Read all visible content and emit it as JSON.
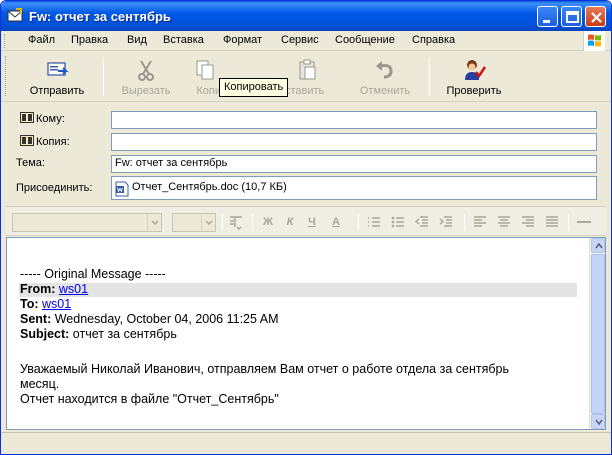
{
  "window": {
    "title": "Fw: отчет за сентябрь",
    "controls": [
      "minimize-icon",
      "maximize-icon",
      "close-icon"
    ]
  },
  "menu": {
    "items": [
      "Файл",
      "Правка",
      "Вид",
      "Вставка",
      "Формат",
      "Сервис",
      "Сообщение",
      "Справка"
    ]
  },
  "toolbar": {
    "send": "Отправить",
    "cut": "Вырезать",
    "copy": "Копировать",
    "paste": "Вставить",
    "undo": "Отменить",
    "check": "Проверить",
    "copy_partial": "Копи",
    "paste_partial": "ставить"
  },
  "tooltip": "Копировать",
  "header": {
    "to_label": "Кому:",
    "to_value": "",
    "cc_label": "Копия:",
    "cc_value": "",
    "subject_label": "Тема:",
    "subject_value": "Fw: отчет за сентябрь",
    "attach_label": "Присоединить:",
    "attachment": "Отчет_Сентябрь.doc (10,7 КБ)"
  },
  "format_bar": {
    "icons": [
      "paragraph-style-icon",
      "bold-icon",
      "italic-icon",
      "underline-icon",
      "font-color-icon",
      "numbered-list-icon",
      "bullet-list-icon",
      "decrease-indent-icon",
      "increase-indent-icon",
      "align-left-icon",
      "align-center-icon",
      "align-right-icon",
      "justify-icon",
      "horizontal-line-icon"
    ],
    "bold_glyph": "Ж",
    "italic_glyph": "К",
    "underline_glyph": "Ч",
    "color_glyph": "А"
  },
  "message": {
    "original_header": "----- Original Message -----",
    "from_label": "From:",
    "from_value": "ws01",
    "to_label": "To:",
    "to_value": "ws01",
    "sent_label": "Sent:",
    "sent_value": "Wednesday, October 04, 2006 11:25 AM",
    "subject_label": "Subject:",
    "subject_value": "отчет за сентябрь",
    "body_line1": "Уважаемый Николай Иванович, отправляем Вам отчет о работе отдела за сентябрь",
    "body_line2": "месяц.",
    "body_line3": "Отчет находится  в файле \"Отчет_Сентябрь\""
  },
  "colors": {
    "titlebar": "#0058e6",
    "window_bg": "#ece9d8",
    "link": "#0000ee",
    "tooltip_bg": "#ffffe1"
  }
}
